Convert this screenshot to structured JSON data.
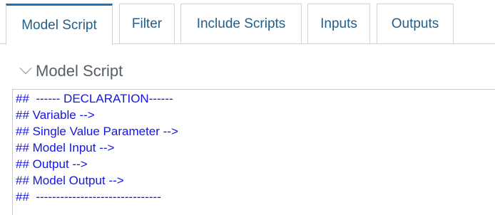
{
  "tabs": [
    {
      "label": "Model Script",
      "active": true
    },
    {
      "label": "Filter",
      "active": false
    },
    {
      "label": "Include Scripts",
      "active": false
    },
    {
      "label": "Inputs",
      "active": false
    },
    {
      "label": "Outputs",
      "active": false
    }
  ],
  "section": {
    "title": "Model Script",
    "icon": "chevron-down-icon"
  },
  "editor": {
    "lines": [
      "##  ------ DECLARATION------",
      "## Variable -->",
      "## Single Value Parameter -->",
      "## Model Input -->",
      "## Output -->",
      "## Model Output -->",
      "##  -------------------------------"
    ]
  },
  "colors": {
    "accent": "#1f6fb2",
    "tab_text": "#1f5f8b",
    "code_text": "#1515e0",
    "border": "#cfd4da"
  }
}
